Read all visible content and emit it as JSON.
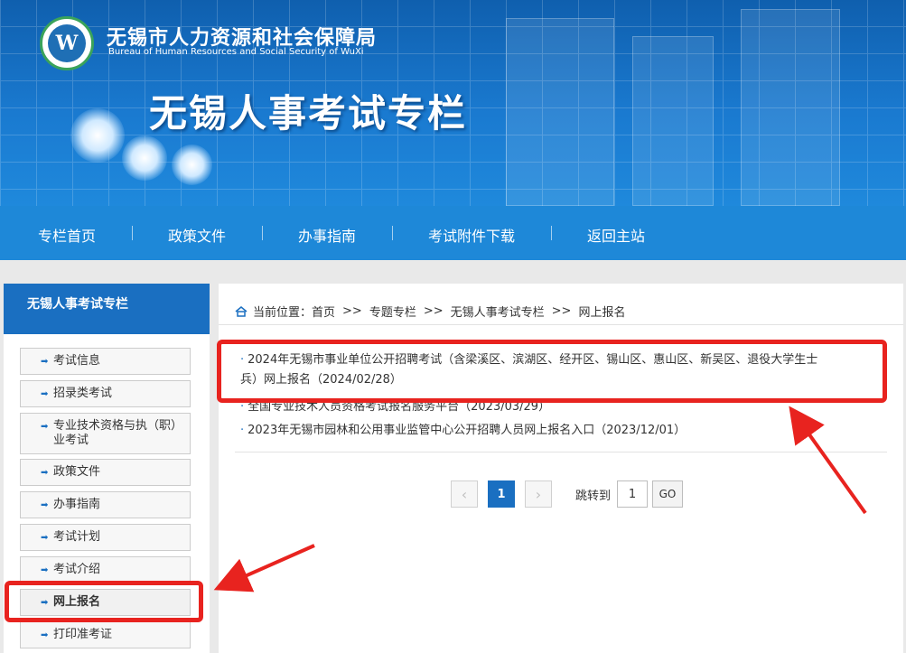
{
  "header": {
    "org_name_cn": "无锡市人力资源和社会保障局",
    "org_name_en": "Bureau of Human Resources and Social Security of WuXi",
    "banner_title": "无锡人事考试专栏"
  },
  "nav": {
    "items": [
      "专栏首页",
      "政策文件",
      "办事指南",
      "考试附件下载",
      "返回主站"
    ]
  },
  "sidebar": {
    "title": "无锡人事考试专栏",
    "items": [
      {
        "label": "考试信息"
      },
      {
        "label": "招录类考试"
      },
      {
        "label": "专业技术资格与执（职）业考试"
      },
      {
        "label": "政策文件"
      },
      {
        "label": "办事指南"
      },
      {
        "label": "考试计划"
      },
      {
        "label": "考试介绍"
      },
      {
        "label": "网上报名",
        "active": true
      },
      {
        "label": "打印准考证"
      }
    ]
  },
  "breadcrumb": {
    "prefix": "当前位置：",
    "parts": [
      "首页",
      "专题专栏",
      "无锡人事考试专栏",
      "网上报名"
    ],
    "separator": ">>"
  },
  "list": {
    "items": [
      {
        "line1": "2024年无锡市事业单位公开招聘考试（含梁溪区、滨湖区、经开区、锡山区、惠山区、新吴区、退役大学生士",
        "line2": "兵）网上报名（2024/02/28）"
      },
      {
        "line1": "全国专业技术人员资格考试报名服务平台（2023/03/29）"
      },
      {
        "line1": "2023年无锡市园林和公用事业监管中心公开招聘人员网上报名入口（2023/12/01）"
      }
    ]
  },
  "pagination": {
    "prev": "‹",
    "current": "1",
    "next": "›",
    "jump_label": "跳转到",
    "jump_value": "1",
    "go_label": "GO"
  },
  "colors": {
    "nav_bg": "#1e88d8",
    "sidebar_header": "#1a6fc1",
    "annotation_red": "#e8231f"
  }
}
